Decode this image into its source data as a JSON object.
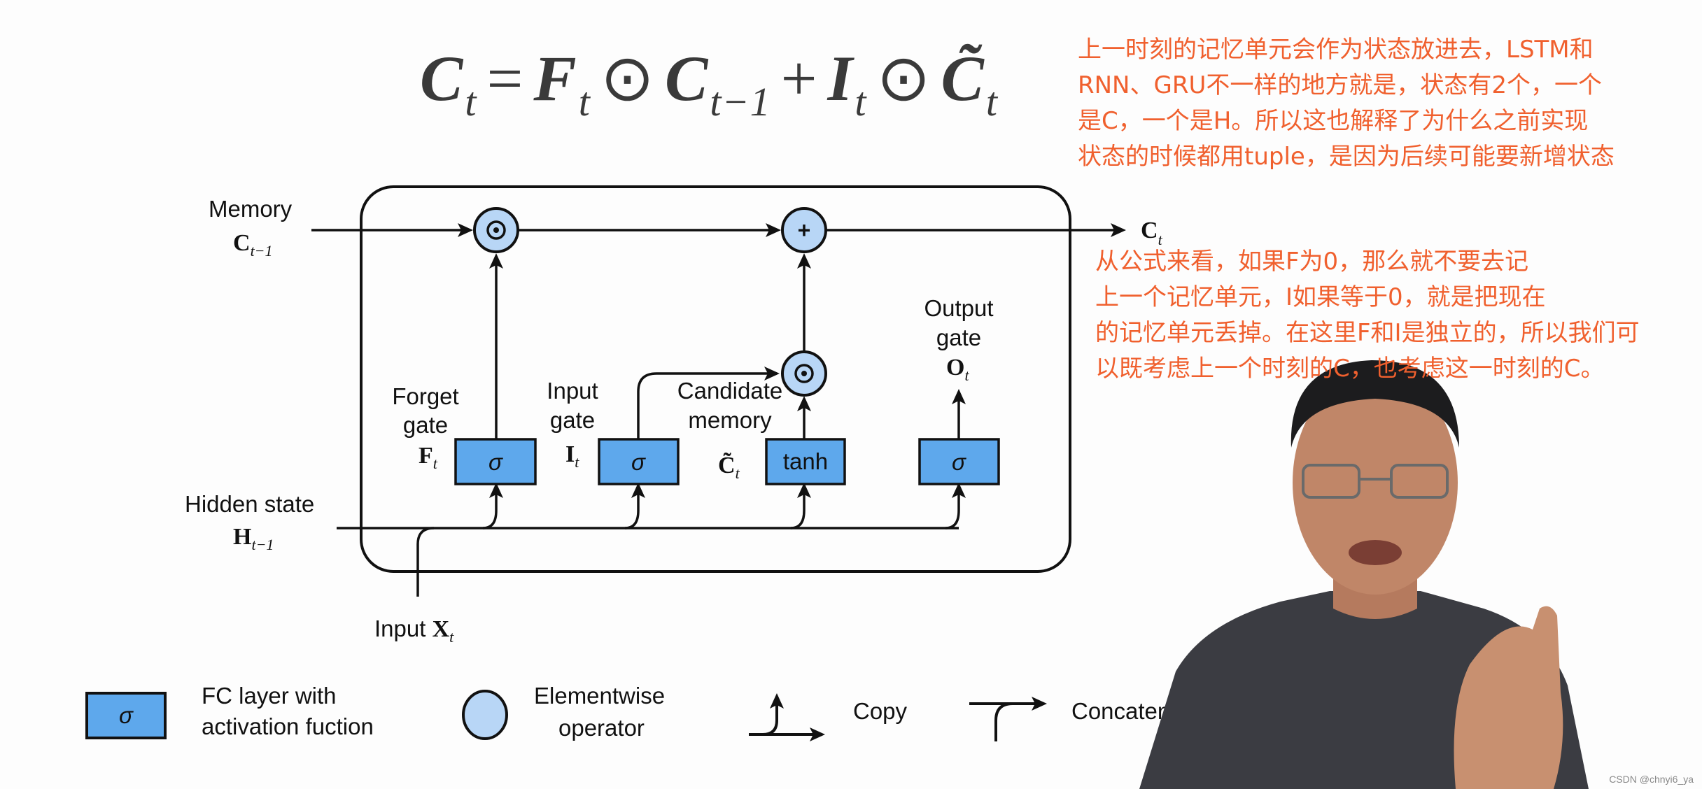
{
  "formula": {
    "lhs": "C",
    "lhs_sub": "t",
    "eq": "=",
    "f": "F",
    "f_sub": "t",
    "odot1": "⊙",
    "c_prev": "C",
    "c_prev_sub": "t−1",
    "plus": "+",
    "i": "I",
    "i_sub": "t",
    "odot2": "⊙",
    "c_tilde": "C̃",
    "c_tilde_sub": "t"
  },
  "notes": {
    "top": [
      "上一时刻的记忆单元会作为状态放进去，LSTM和",
      "RNN、GRU不一样的地方就是，状态有2个，一个",
      "是C，一个是H。所以这也解释了为什么之前实现",
      "状态的时候都用tuple，是因为后续可能要新增状态"
    ],
    "right": [
      "从公式来看，如果F为0，那么就不要去记",
      "上一个记忆单元，I如果等于0，就是把现在",
      "的记忆单元丢掉。在这里F和I是独立的，所以我们可",
      "以既考虑上一个时刻的C，也考虑这一时刻的C。"
    ]
  },
  "diagram": {
    "memory_label": "Memory",
    "memory_var": "C",
    "memory_sub": "t−1",
    "output_var": "C",
    "output_sub": "t",
    "hidden_label": "Hidden state",
    "hidden_var": "H",
    "hidden_sub": "t−1",
    "input_label": "Input ",
    "input_var": "X",
    "input_sub": "t",
    "forget": {
      "line1": "Forget",
      "line2": "gate",
      "var": "F",
      "sub": "t",
      "box": "σ"
    },
    "input_gate": {
      "line1": "Input",
      "line2": "gate",
      "var": "I",
      "sub": "t",
      "box": "σ"
    },
    "candidate": {
      "line1": "Candidate",
      "line2": "memory",
      "var": "C̃",
      "sub": "t",
      "box": "tanh"
    },
    "output_gate": {
      "line1": "Output",
      "line2": "gate",
      "var": "O",
      "sub": "t",
      "box": "σ"
    },
    "op_multiply": "⊙",
    "op_plus": "+"
  },
  "legend": {
    "fc_symbol": "σ",
    "fc_line1": "FC layer with",
    "fc_line2": "activation fuction",
    "elem_line1": "Elementwise",
    "elem_line2": "operator",
    "copy": "Copy",
    "concat": "Concaten"
  },
  "colors": {
    "fc_box": "#5ea8ec",
    "elementwise": "#b8d6f6",
    "annotation": "#f0602e"
  },
  "watermark": "CSDN @chnyi6_ya"
}
